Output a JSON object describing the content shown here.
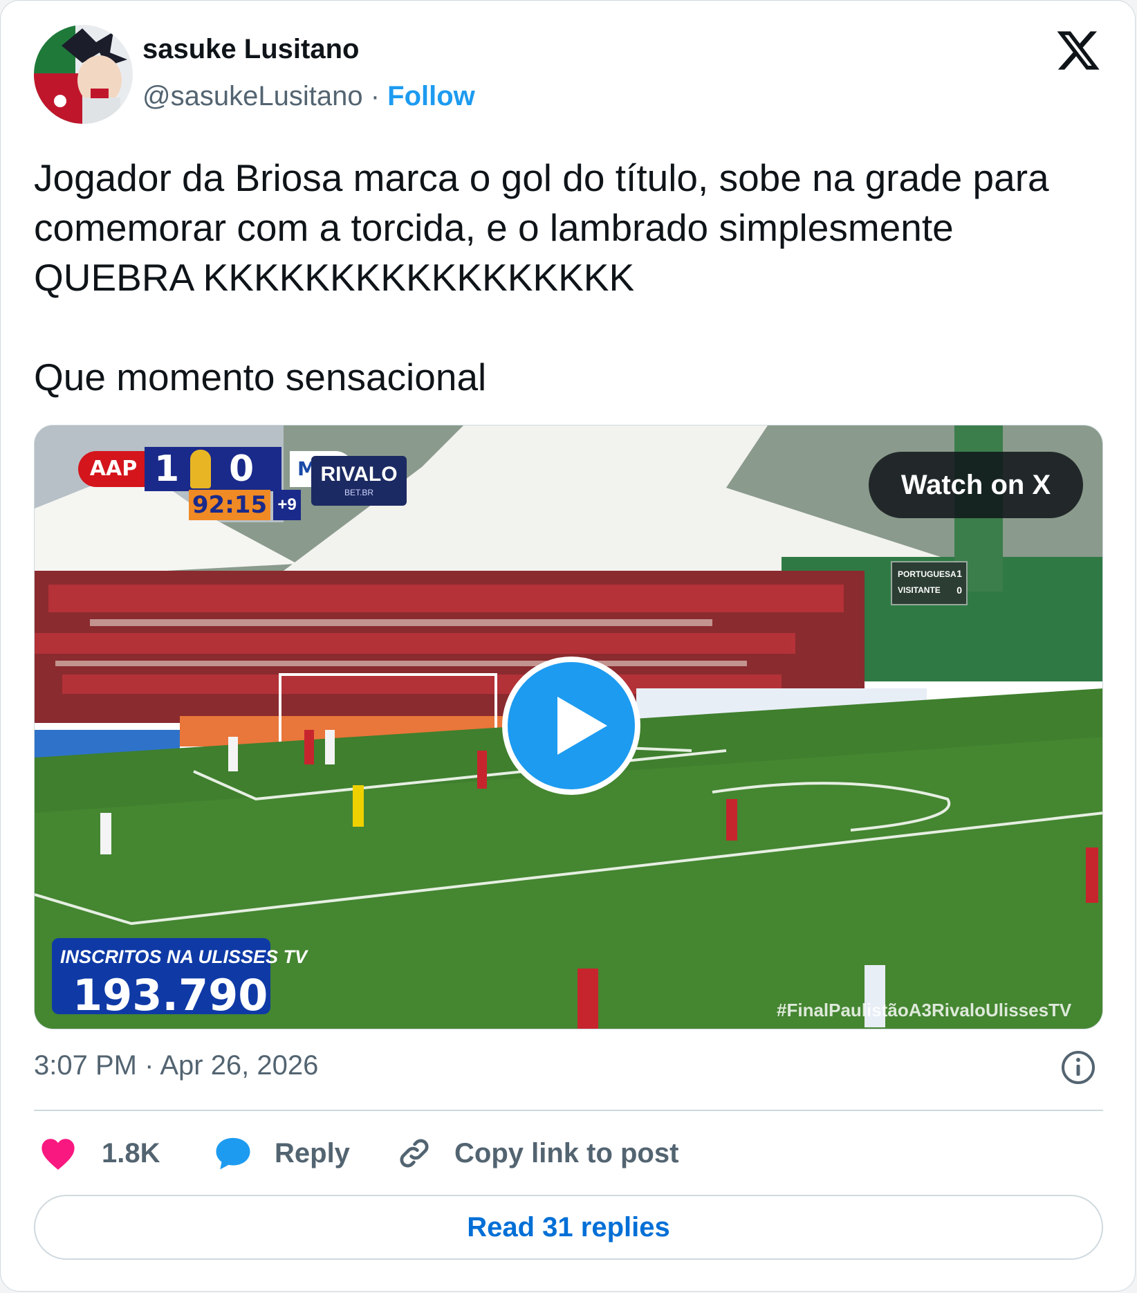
{
  "user": {
    "name": "sasuke Lusitano",
    "handle": "@sasukeLusitano",
    "separator": "·",
    "follow_label": "Follow"
  },
  "tweet": {
    "paragraphs": [
      "Jogador da Briosa marca o gol do título, sobe na grade para comemorar com a torcida, e o lambrado simplesmente QUEBRA KKKKKKKKKKKKKKKKK",
      "Que momento sensacional"
    ]
  },
  "media": {
    "watch_label": "Watch on X",
    "scorebug": {
      "home": "AAP",
      "home_score": "1",
      "away_score": "0",
      "away": "MAC",
      "clock": "92:15",
      "added": "+9"
    },
    "sponsor": {
      "name": "RIVALO",
      "sub": "BET.BR"
    },
    "scoreboard": {
      "home": "PORTUGUESA",
      "home_val": "1",
      "away": "VISITANTE",
      "away_val": "0"
    },
    "subscribers": {
      "label": "INSCRITOS NA ULISSES TV",
      "value": "193.790"
    },
    "hashtag": "#FinalPaulistãoA3RivaloUlissesTV"
  },
  "footer": {
    "time": "3:07 PM",
    "separator": "·",
    "date": "Apr 26, 2026",
    "likes": "1.8K",
    "reply_label": "Reply",
    "copy_label": "Copy link to post",
    "read_label": "Read 31 replies"
  },
  "icons": {
    "like": "heart-icon",
    "reply": "speech-bubble-icon",
    "copy": "link-icon",
    "info": "info-icon",
    "logo": "x-logo-icon",
    "play": "play-icon"
  },
  "colors": {
    "accent": "#1d9bf0",
    "link": "#006fd6",
    "like": "#f91880",
    "muted": "#536471",
    "text": "#0f1419",
    "border": "#cfd9de"
  }
}
